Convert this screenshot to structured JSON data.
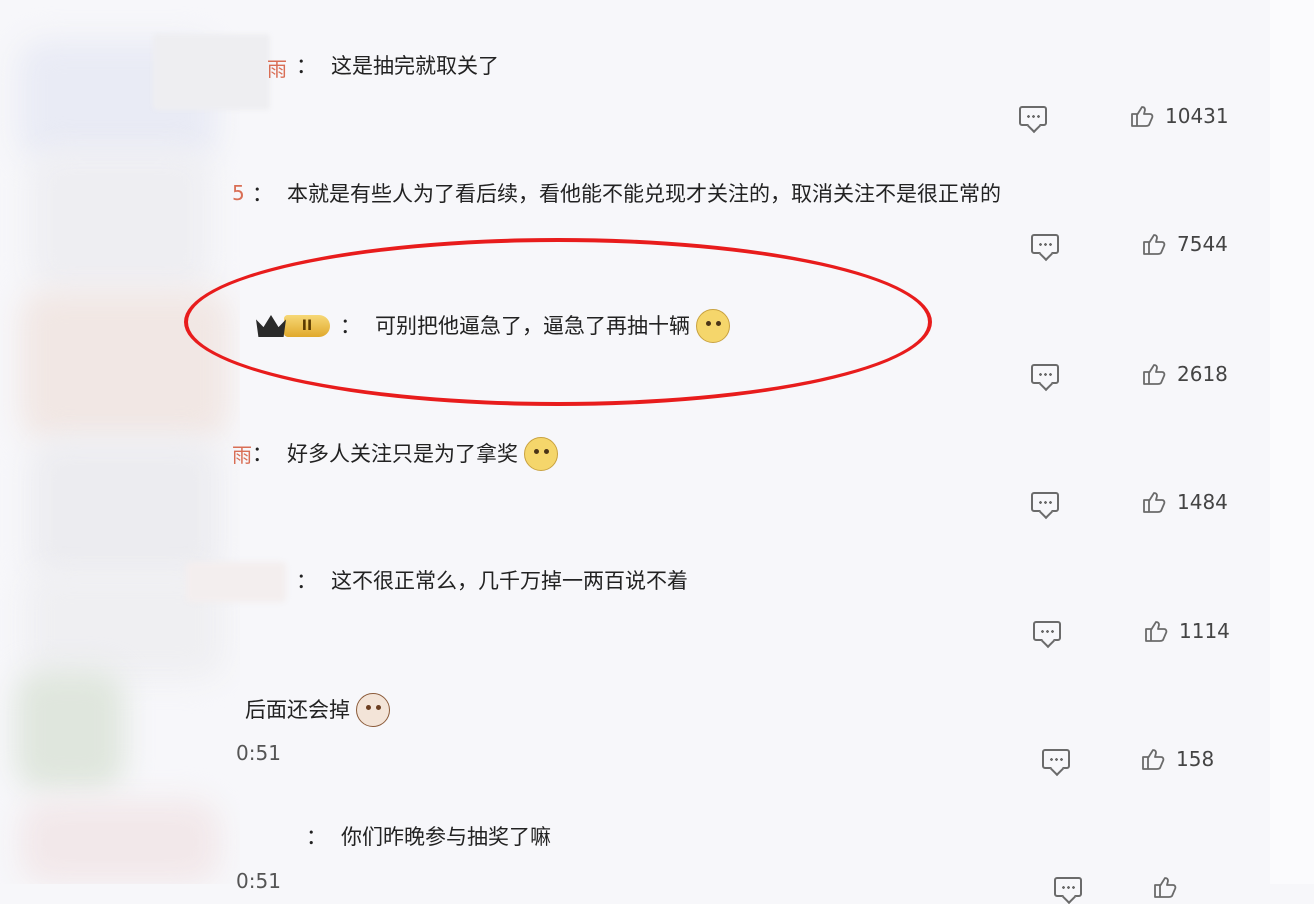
{
  "comments": [
    {
      "name_fragment": "雨",
      "text": "这是抽完就取关了",
      "likes": "10431"
    },
    {
      "name_fragment": "5",
      "text": "本就是有些人为了看后续，看他能不能兑现才关注的，取消关注不是很正常的",
      "likes": "7544"
    },
    {
      "name_fragment": "",
      "badge_level": "II",
      "text": "可别把他逼急了，逼急了再抽十辆",
      "likes": "2618"
    },
    {
      "name_fragment": "雨",
      "text": "好多人关注只是为了拿奖",
      "likes": "1484"
    },
    {
      "name_fragment": "",
      "text": "这不很正常么，几千万掉一两百说不着",
      "likes": "1114"
    },
    {
      "name_fragment": "",
      "text": "后面还会掉",
      "time": "0:51",
      "likes": "158"
    },
    {
      "name_fragment": "",
      "text": "你们昨晚参与抽奖了嘛",
      "time": "0:51",
      "likes": ""
    }
  ],
  "colon": "：",
  "icons": {
    "reply": "reply-icon",
    "like": "thumbs-up-icon",
    "emoji": "doge-emoji-icon"
  },
  "colors": {
    "highlight": "#e81c1c",
    "username": "#d96e55"
  }
}
